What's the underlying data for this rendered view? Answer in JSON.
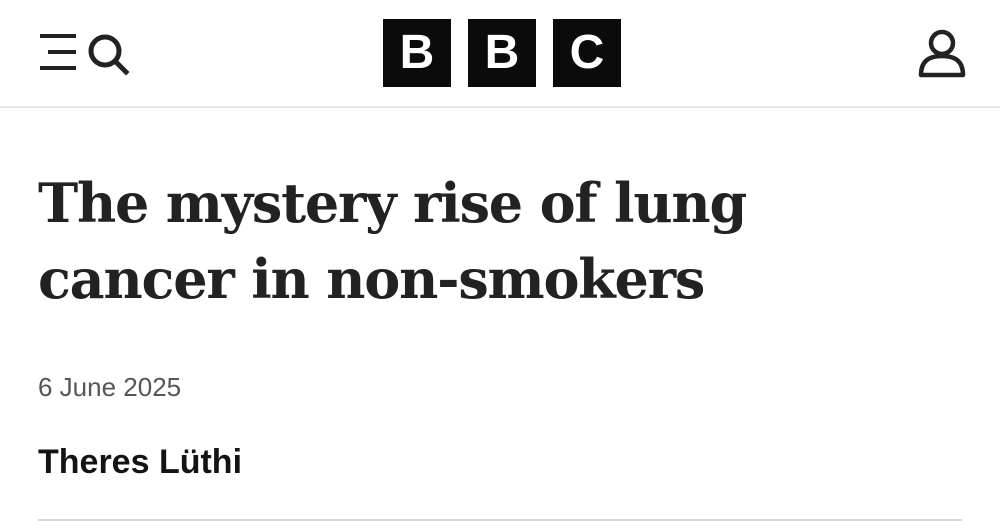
{
  "header": {
    "menu_icon": "hamburger-menu-icon",
    "search_icon": "search-icon",
    "logo": [
      "B",
      "B",
      "C"
    ],
    "account_icon": "user-account-icon"
  },
  "article": {
    "headline_line1": "The mystery rise of lung",
    "headline_line2": "cancer in non-smokers",
    "date": "6 June 2025",
    "author": "Theres Lüthi"
  },
  "colors": {
    "text": "#202224",
    "date_text": "#545658",
    "logo_block": "#0b0b0b",
    "logo_text": "#ffffff",
    "divider": "#d5d7d9"
  }
}
